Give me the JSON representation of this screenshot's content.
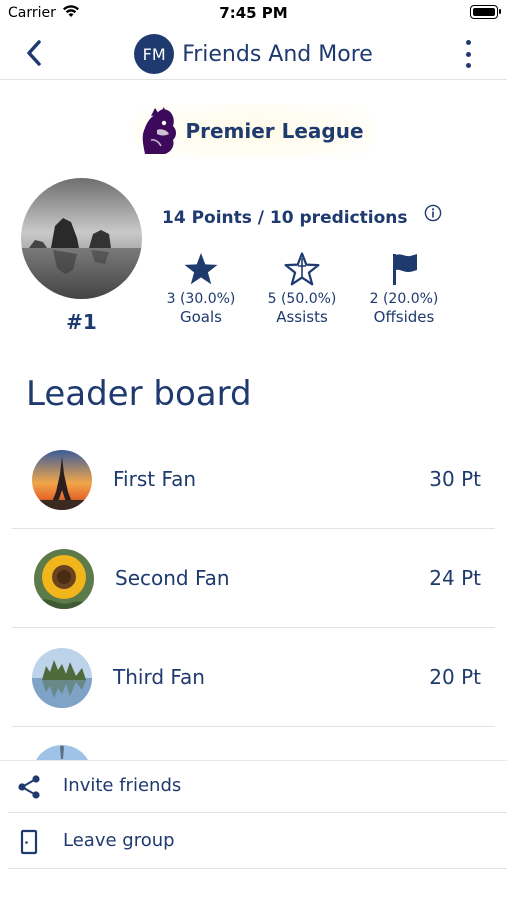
{
  "status_bar": {
    "carrier": "Carrier",
    "time": "7:45 PM"
  },
  "nav": {
    "avatar_initials": "FM",
    "title": "Friends And More"
  },
  "league": {
    "name": "Premier League"
  },
  "profile": {
    "rank": "#1",
    "points_summary": "14 Points / 10 predictions",
    "stats": [
      {
        "icon": "star-icon",
        "value": "3 (30.0%)",
        "label": "Goals"
      },
      {
        "icon": "star-outline-icon",
        "value": "5 (50.0%)",
        "label": "Assists"
      },
      {
        "icon": "flag-icon",
        "value": "2 (20.0%)",
        "label": "Offsides"
      }
    ]
  },
  "leaderboard": {
    "title": "Leader board",
    "entries": [
      {
        "name": "First Fan",
        "points": "30 Pt"
      },
      {
        "name": "Second Fan",
        "points": "24 Pt"
      },
      {
        "name": "Third Fan",
        "points": "20 Pt"
      }
    ]
  },
  "menu": {
    "invite_label": "Invite friends",
    "leave_label": "Leave group"
  },
  "colors": {
    "primary": "#1e3a6e",
    "divider": "#e3e3e3"
  }
}
